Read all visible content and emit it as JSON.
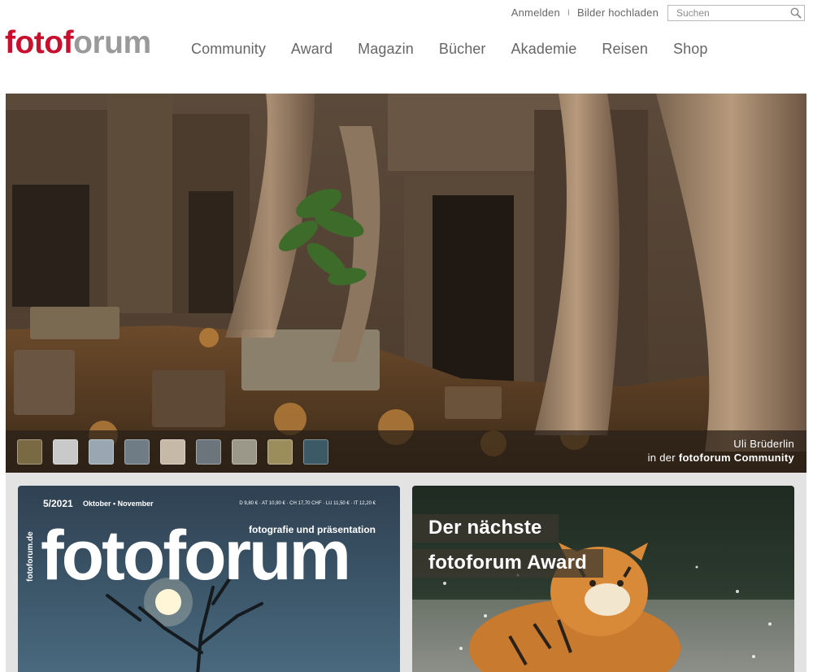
{
  "utility": {
    "login": "Anmelden",
    "separator": "I",
    "upload": "Bilder hochladen",
    "search_placeholder": "Suchen"
  },
  "logo": {
    "part1": "foto",
    "part2": "f",
    "part3": "orum"
  },
  "nav": [
    "Community",
    "Award",
    "Magazin",
    "Bücher",
    "Akademie",
    "Reisen",
    "Shop"
  ],
  "hero": {
    "photographer": "Uli Brüderlin",
    "credit_prefix": "in der",
    "credit_link": "fotoforum Community",
    "thumb_colors": [
      "#7a6a44",
      "#c9c9c9",
      "#9aa7b3",
      "#6f7c86",
      "#c7b9a8",
      "#6c747c",
      "#9b9889",
      "#9c8e5c",
      "#3b5a66"
    ]
  },
  "magazine": {
    "issue": "5/2021",
    "months": "Oktober • November",
    "price": "D 9,80 € · AT 10,90 € · CH 17,70 CHF · LU 11,50 € · IT 12,20 €",
    "side_text": "fotoforum.de",
    "tagline": "fotografie und präsentation",
    "title": "fotoforum"
  },
  "award": {
    "line1": "Der nächste",
    "line2": "fotoforum Award"
  },
  "colors": {
    "brand_red": "#c8102e",
    "logo_gray": "#9a9a9a",
    "nav_text": "#666666",
    "lower_bg": "#e3e3e3"
  }
}
